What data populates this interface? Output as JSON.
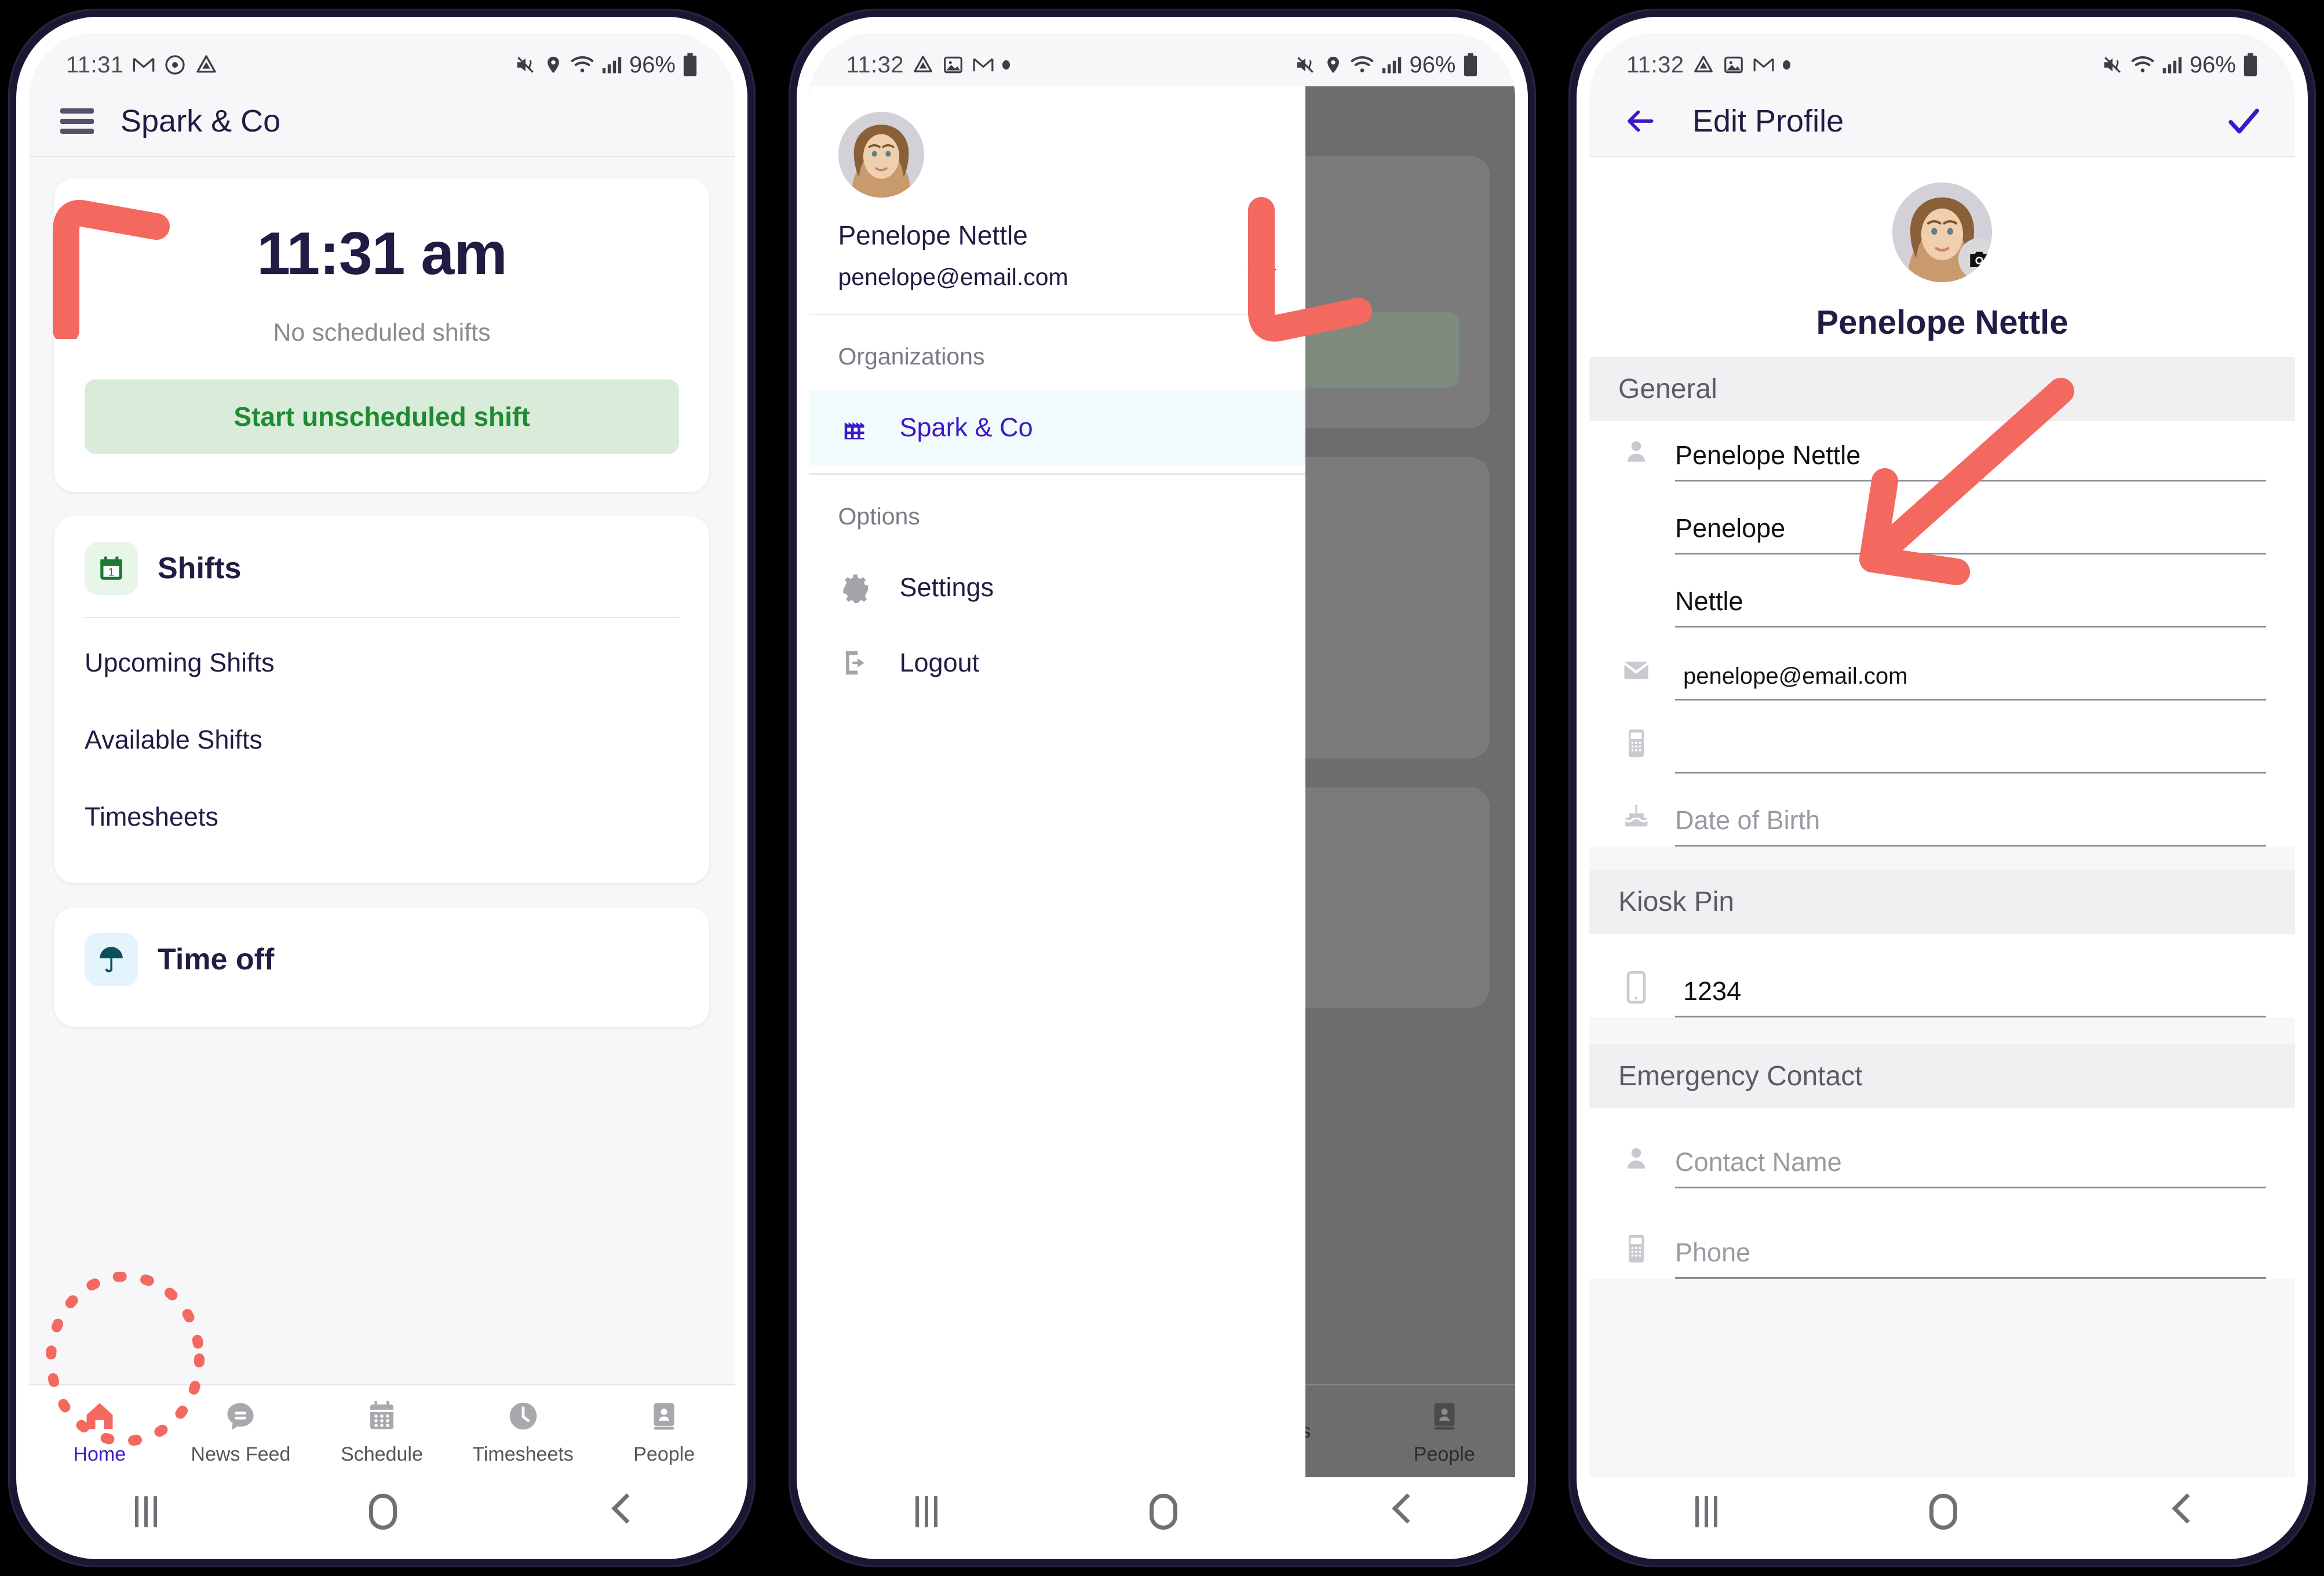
{
  "accent": {
    "annotation_red": "#f4695f",
    "brand_purple": "#3c18c9",
    "title_navy": "#221b43",
    "green_text": "#1e8a32",
    "green_bg": "#d8ecd9"
  },
  "phone1": {
    "status": {
      "time": "11:31",
      "battery": "96%",
      "left_icons": [
        "gmail-icon",
        "meet-icon",
        "drive-icon"
      ],
      "right_icons": [
        "mute-vibrate-icon",
        "location-icon",
        "wifi-icon",
        "signal-icon",
        "battery-icon"
      ]
    },
    "appbar": {
      "menu_icon": "hamburger-icon",
      "title": "Spark & Co"
    },
    "clock_card": {
      "time": "11:31 am",
      "status_text": "No scheduled shifts",
      "button_label": "Start unscheduled shift"
    },
    "shifts_card": {
      "icon": "calendar-icon",
      "title": "Shifts",
      "links": [
        "Upcoming Shifts",
        "Available Shifts",
        "Timesheets"
      ]
    },
    "timeoff_card": {
      "icon": "umbrella-icon",
      "title": "Time off"
    },
    "bottom_nav": [
      {
        "label": "Home",
        "icon": "home-icon",
        "active": true
      },
      {
        "label": "News Feed",
        "icon": "chat-icon",
        "active": false
      },
      {
        "label": "Schedule",
        "icon": "calendar-grid-icon",
        "active": false
      },
      {
        "label": "Timesheets",
        "icon": "clock-icon",
        "active": false
      },
      {
        "label": "People",
        "icon": "contacts-icon",
        "active": false
      }
    ],
    "annotation": "red-elbow-arrow-pointing-to-hamburger"
  },
  "phone2": {
    "status": {
      "time": "11:32",
      "battery": "96%",
      "left_icons": [
        "drive-icon",
        "photos-icon",
        "gmail-icon",
        "dot-icon"
      ],
      "right_icons": [
        "mute-vibrate-icon",
        "location-icon",
        "wifi-icon",
        "signal-icon",
        "battery-icon"
      ]
    },
    "drawer": {
      "user_name": "Penelope Nettle",
      "user_email": "penelope@email.com",
      "caret_icon": "chevron-down-icon",
      "avatar": "user-avatar",
      "sections": [
        {
          "label": "Organizations",
          "items": [
            {
              "label": "Spark & Co",
              "icon": "factory-icon",
              "selected": true
            }
          ]
        },
        {
          "label": "Options",
          "items": [
            {
              "label": "Settings",
              "icon": "gear-icon",
              "selected": false
            },
            {
              "label": "Logout",
              "icon": "logout-icon",
              "selected": false
            }
          ]
        }
      ]
    },
    "behind_nav": [
      {
        "label": "ts"
      },
      {
        "label": "People"
      }
    ],
    "annotation": "red-elbow-arrow-pointing-to-dropdown-caret"
  },
  "phone3": {
    "status": {
      "time": "11:32",
      "battery": "96%",
      "left_icons": [
        "drive-icon",
        "photos-icon",
        "gmail-icon",
        "dot-icon"
      ],
      "right_icons": [
        "mute-vibrate-icon",
        "wifi-icon",
        "signal-icon",
        "battery-icon"
      ]
    },
    "appbar": {
      "back_icon": "back-arrow-icon",
      "title": "Edit Profile",
      "save_icon": "check-icon"
    },
    "hero": {
      "name": "Penelope Nettle",
      "camera_badge": "camera-icon"
    },
    "sections": [
      {
        "label": "General",
        "fields": [
          {
            "icon": "person-icon",
            "value": "Penelope Nettle",
            "placeholder": ""
          },
          {
            "icon": "",
            "value": "Penelope",
            "placeholder": ""
          },
          {
            "icon": "",
            "value": "Nettle",
            "placeholder": ""
          },
          {
            "icon": "mail-icon",
            "value": "penelope@email.com",
            "placeholder": "",
            "small": true
          },
          {
            "icon": "mobile-icon",
            "value": "",
            "placeholder": ""
          },
          {
            "icon": "cake-icon",
            "value": "",
            "placeholder": "Date of Birth"
          }
        ]
      },
      {
        "label": "Kiosk Pin",
        "fields": [
          {
            "icon": "smartphone-icon",
            "value": "1234",
            "placeholder": ""
          }
        ]
      },
      {
        "label": "Emergency Contact",
        "fields": [
          {
            "icon": "person-icon",
            "value": "",
            "placeholder": "Contact Name"
          },
          {
            "icon": "mobile-icon",
            "value": "",
            "placeholder": "Phone"
          }
        ]
      }
    ],
    "annotation": "red-arrow-pointing-to-kiosk-pin-value"
  }
}
